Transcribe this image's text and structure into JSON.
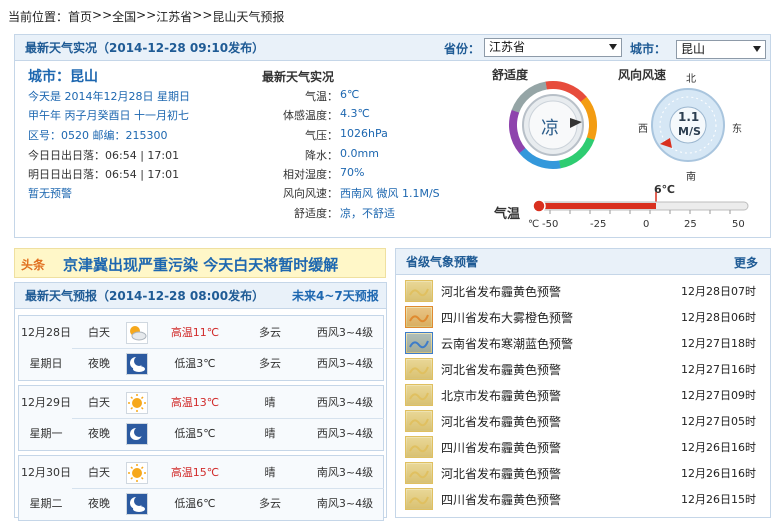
{
  "breadcrumb": {
    "label": "当前位置：",
    "home": "首页",
    "sep1": ">>",
    "country": "全国",
    "sep2": ">>",
    "province": "江苏省",
    "sep3": ">>",
    "page": "昆山天气预报"
  },
  "current": {
    "header_title": "最新天气实况（2014-12-28  09:10发布）",
    "province_label": "省份：",
    "province_value": "江苏省",
    "city_label": "城市：",
    "city_value": "昆山",
    "city_title": "城市：昆山",
    "date_line": "今天是 2014年12月28日 星期日",
    "lunar_line": "甲午年 丙子月癸酉日 十一月初七",
    "code_line": "区号：0520  邮编：215300",
    "sun_today": "今日日出日落：06:54  |  17:01",
    "sun_tomorrow": "明日日出日落：06:54  |  17:01",
    "no_alert": "暂无预警",
    "obs_title": "最新天气实况",
    "obs": [
      {
        "k": "气温：",
        "v": "6℃"
      },
      {
        "k": "体感温度：",
        "v": "4.3℃"
      },
      {
        "k": "气压：",
        "v": "1026hPa"
      },
      {
        "k": "降水：",
        "v": "0.0mm"
      },
      {
        "k": "相对湿度：",
        "v": "70%"
      },
      {
        "k": "风向风速：",
        "v": "西南风 微风 1.1M/S"
      },
      {
        "k": "舒适度：",
        "v": "凉，不舒适"
      }
    ],
    "comfort_label": "舒适度",
    "comfort_value": "凉",
    "wind_label": "风向风速",
    "wind_speed": "1.1",
    "wind_unit": "M/S",
    "dir_n": "北",
    "dir_s": "南",
    "dir_e": "东",
    "dir_w": "西",
    "temp_label": "气温",
    "temp_value": "6℃",
    "temp_unit": "℃",
    "temp_ticks": [
      "-50",
      "-25",
      "0",
      "25",
      "50"
    ]
  },
  "headline": {
    "tag": "头条",
    "text": "京津冀出现严重污染  今天白天将暂时缓解"
  },
  "forecast": {
    "title": "最新天气预报（2014-12-28  08:00发布）",
    "more": "未来4~7天预报",
    "days": [
      {
        "date": "12月28日",
        "week": "星期日",
        "day": {
          "period": "白天",
          "icon": "cloudy-sun-icon",
          "temp": "高温11℃",
          "weather": "多云",
          "wind": "西风3~4级"
        },
        "night": {
          "period": "夜晚",
          "icon": "moon-cloud-icon",
          "temp": "低温3℃",
          "weather": "多云",
          "wind": "西风3~4级"
        }
      },
      {
        "date": "12月29日",
        "week": "星期一",
        "day": {
          "period": "白天",
          "icon": "sun-icon",
          "temp": "高温13℃",
          "weather": "晴",
          "wind": "西风3~4级"
        },
        "night": {
          "period": "夜晚",
          "icon": "moon-icon",
          "temp": "低温5℃",
          "weather": "晴",
          "wind": "西风3~4级"
        }
      },
      {
        "date": "12月30日",
        "week": "星期二",
        "day": {
          "period": "白天",
          "icon": "sun-icon",
          "temp": "高温15℃",
          "weather": "晴",
          "wind": "南风3~4级"
        },
        "night": {
          "period": "夜晚",
          "icon": "moon-cloud-icon",
          "temp": "低温6℃",
          "weather": "多云",
          "wind": "南风3~4级"
        }
      }
    ]
  },
  "warnings": {
    "title": "省级气象预警",
    "more": "更多",
    "items": [
      {
        "text": "河北省发布霾黄色预警",
        "time": "12月28日07时",
        "color": "#e0c060"
      },
      {
        "text": "四川省发布大雾橙色预警",
        "time": "12月28日06时",
        "color": "#e08a30"
      },
      {
        "text": "云南省发布寒潮蓝色预警",
        "time": "12月27日18时",
        "color": "#3d7cc9"
      },
      {
        "text": "河北省发布霾黄色预警",
        "time": "12月27日16时",
        "color": "#e0c060"
      },
      {
        "text": "北京市发布霾黄色预警",
        "time": "12月27日09时",
        "color": "#e0c060"
      },
      {
        "text": "河北省发布霾黄色预警",
        "time": "12月27日05时",
        "color": "#e0c060"
      },
      {
        "text": "四川省发布霾黄色预警",
        "time": "12月26日16时",
        "color": "#e0c060"
      },
      {
        "text": "河北省发布霾黄色预警",
        "time": "12月26日16时",
        "color": "#e0c060"
      },
      {
        "text": "四川省发布霾黄色预警",
        "time": "12月26日15时",
        "color": "#e0c060"
      }
    ]
  }
}
